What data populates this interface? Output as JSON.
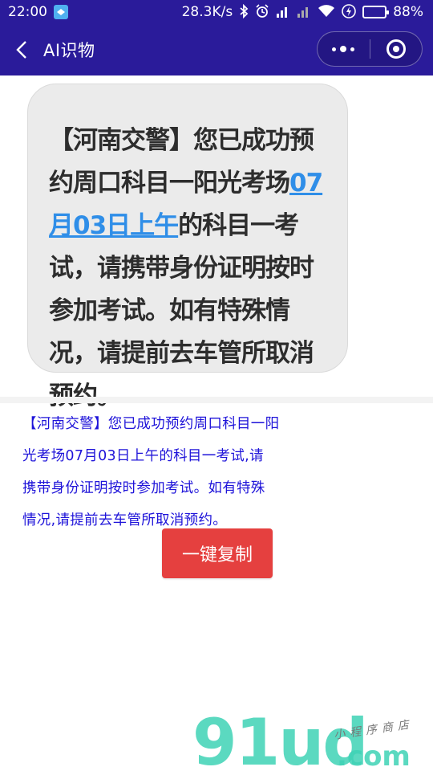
{
  "status_bar": {
    "time": "22:00",
    "network_speed": "28.3K/s",
    "battery_percent_label": "88%",
    "battery_level": 0.88,
    "icons": [
      "app-notification-icon",
      "bluetooth-icon",
      "alarm-icon",
      "signal-icon",
      "signal-icon-2",
      "wifi-icon",
      "charging-icon",
      "battery-icon"
    ]
  },
  "nav": {
    "title": "AI识物"
  },
  "photo": {
    "sms_prefix": "【河南交警】您已成功预约周口科目一阳光考场",
    "sms_link": "07月03日上午",
    "sms_suffix": "的科目一考试，请携带身份证明按时参加考试。如有特殊情况，请提前去车管所取消预约。"
  },
  "result": {
    "lines": [
      "【河南交警】您已成功预约周口科目一阳",
      "光考场07月03日上午的科目一考试,请",
      "携带身份证明按时参加考试。如有特殊",
      "情况,请提前去车管所取消预约。"
    ]
  },
  "actions": {
    "copy_label": "一键复制"
  },
  "watermark": {
    "logo": "91ud",
    "domain": ".com",
    "tagline": "小程序商店"
  },
  "colors": {
    "header_bg": "#2a1b9a",
    "result_text": "#1e13d9",
    "copy_button": "#e5403f",
    "link": "#2f8ee8",
    "watermark": "#3fd3b6"
  }
}
